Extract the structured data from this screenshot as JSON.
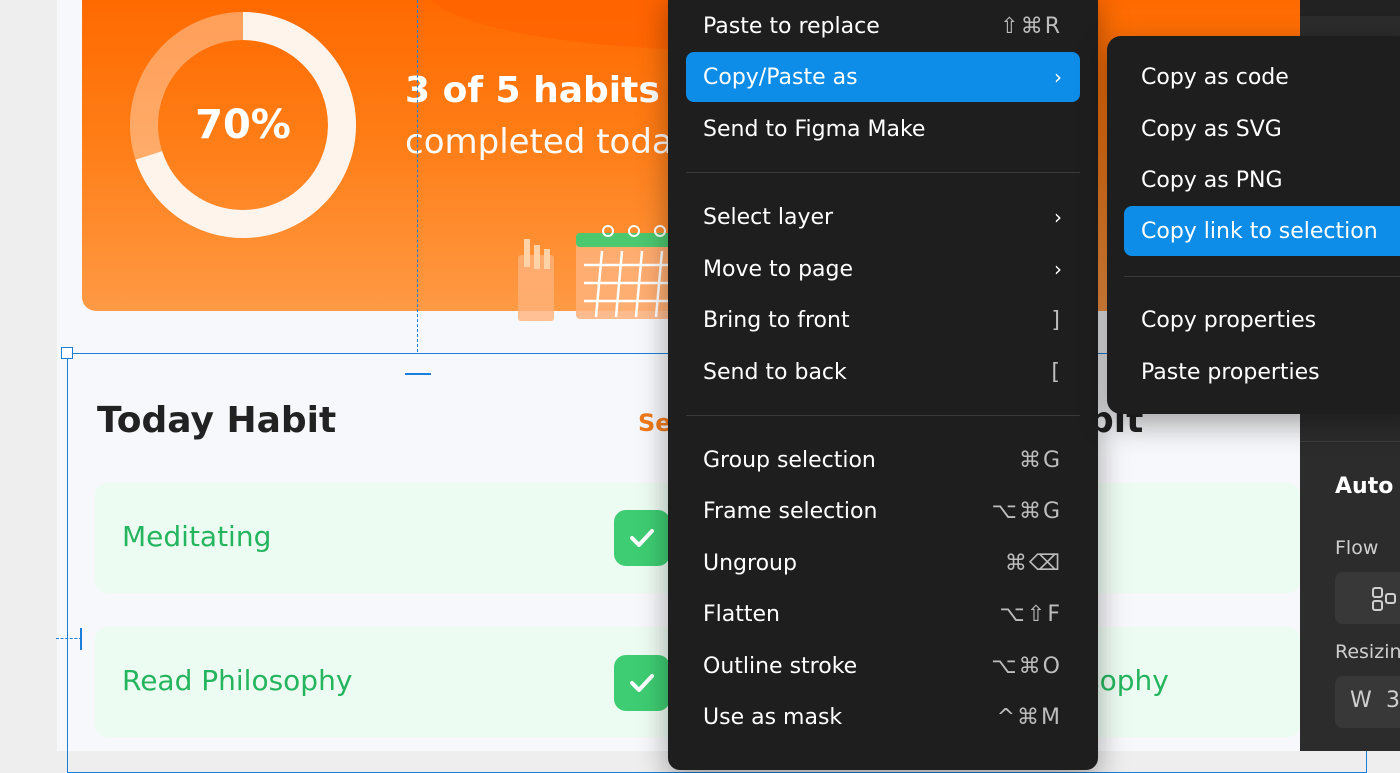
{
  "canvas": {
    "hero": {
      "progress_label": "70%",
      "progress_value": 0.7,
      "count_text": "3 of 5 habits",
      "subtitle_text": "completed toda"
    },
    "section": {
      "title": "Today Habit",
      "see_all_text": "Se",
      "duplicate_title_text": "bit"
    },
    "habits": [
      {
        "label": "Meditating",
        "checked": true
      },
      {
        "label": "Read Philosophy",
        "checked": true
      }
    ],
    "duplicate_habit_text": "sophy"
  },
  "context_menu": {
    "items": [
      {
        "label": "Paste to replace",
        "shortcut": "⇧⌘R",
        "submenu": false
      },
      {
        "label": "Copy/Paste as",
        "shortcut": "",
        "submenu": true,
        "active": true
      },
      {
        "label": "Send to Figma Make",
        "shortcut": "",
        "submenu": false
      },
      {
        "label": "Select layer",
        "shortcut": "",
        "submenu": true
      },
      {
        "label": "Move to page",
        "shortcut": "",
        "submenu": true
      },
      {
        "label": "Bring to front",
        "shortcut": "]",
        "submenu": false
      },
      {
        "label": "Send to back",
        "shortcut": "[",
        "submenu": false
      },
      {
        "label": "Group selection",
        "shortcut": "⌘G",
        "submenu": false
      },
      {
        "label": "Frame selection",
        "shortcut": "⌥⌘G",
        "submenu": false
      },
      {
        "label": "Ungroup",
        "shortcut": "⌘⌫",
        "submenu": false
      },
      {
        "label": "Flatten",
        "shortcut": "⌥⇧F",
        "submenu": false
      },
      {
        "label": "Outline stroke",
        "shortcut": "⌥⌘O",
        "submenu": false
      },
      {
        "label": "Use as mask",
        "shortcut": "^⌘M",
        "submenu": false
      }
    ],
    "submenu_arrow": "›"
  },
  "submenu": {
    "items": [
      {
        "label": "Copy as code"
      },
      {
        "label": "Copy as SVG"
      },
      {
        "label": "Copy as PNG"
      },
      {
        "label": "Copy link to selection",
        "active": true
      },
      {
        "label": "Copy properties"
      },
      {
        "label": "Paste properties"
      }
    ]
  },
  "properties_panel": {
    "section_title": "Auto l",
    "flow_label": "Flow",
    "resizing_label": "Resizin",
    "width_label": "W",
    "width_value": "3"
  },
  "colors": {
    "accent": "#0d8ce8",
    "hero_orange": "#ff7d16",
    "habit_green": "#25b55e",
    "menu_bg": "#1e1e1e"
  }
}
